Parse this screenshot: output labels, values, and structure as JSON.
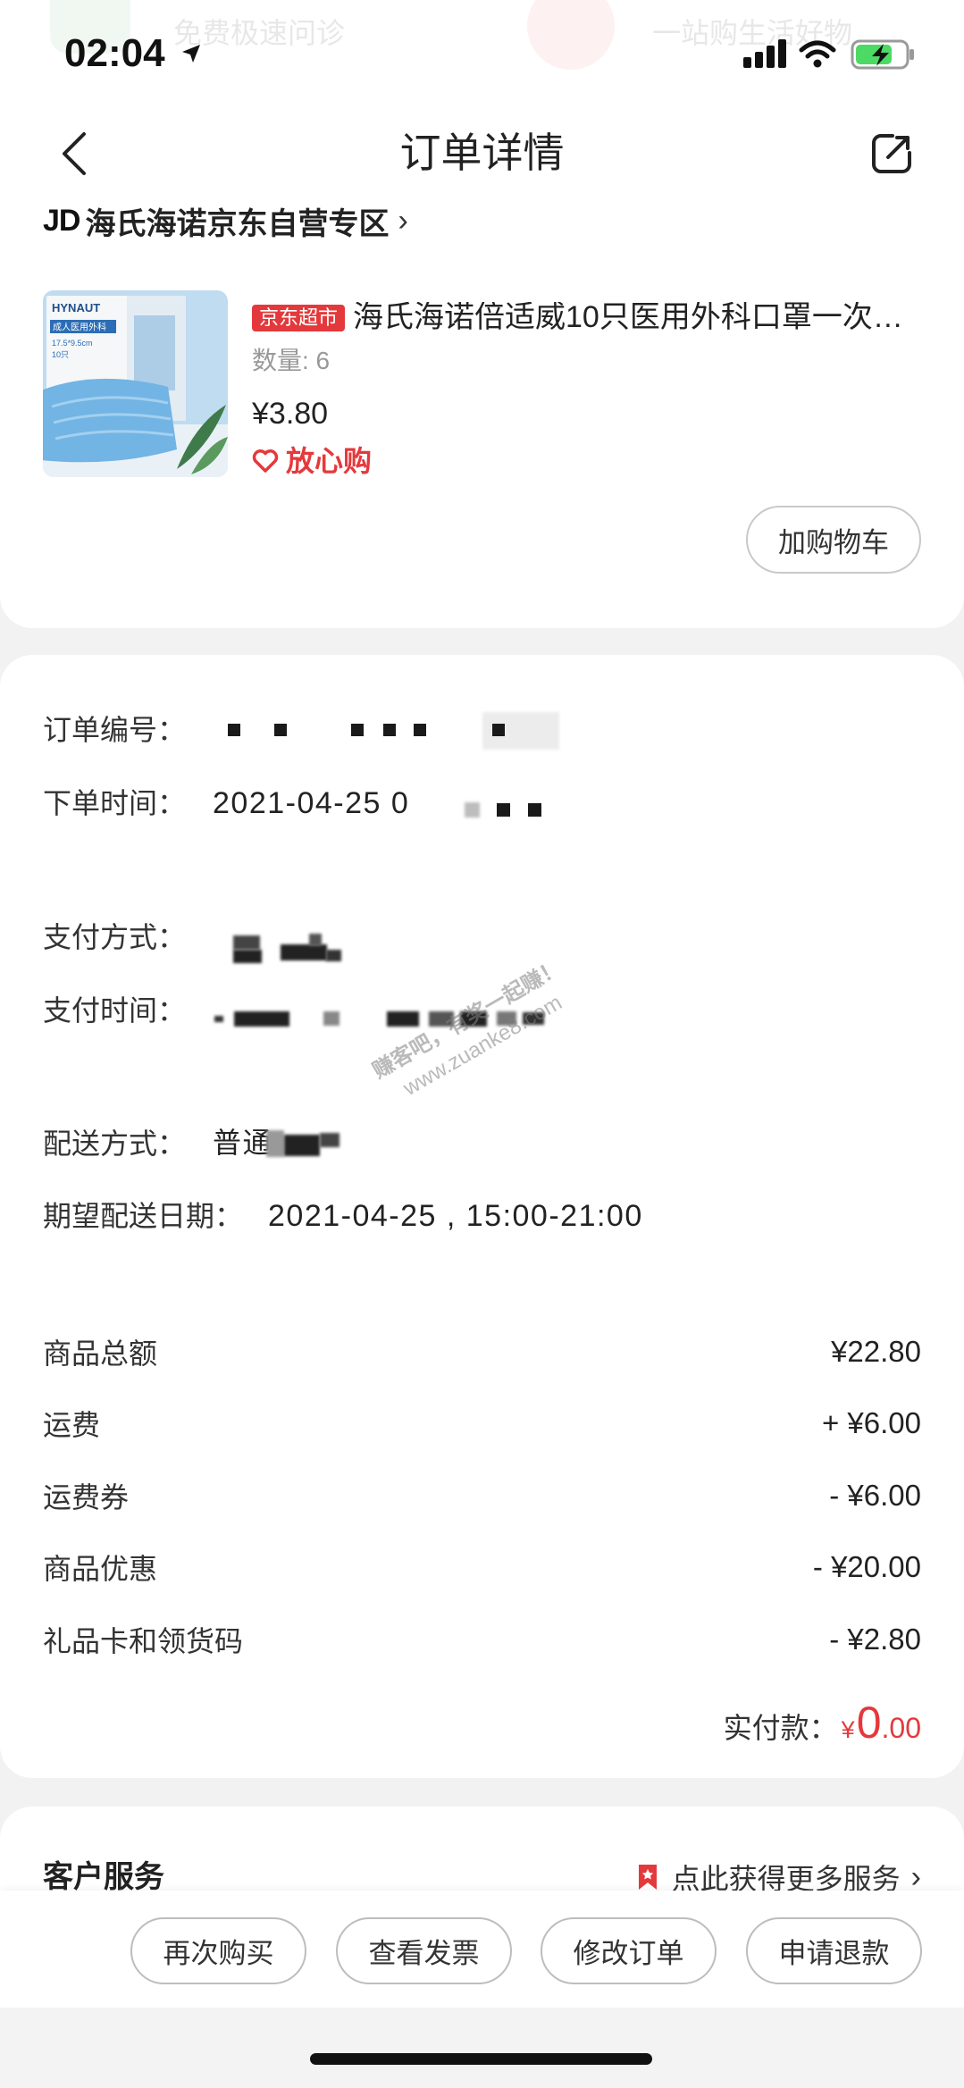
{
  "status_bar": {
    "time": "02:04"
  },
  "underlay": {
    "left_text": "免费极速问诊",
    "right_text": "一站购生活好物"
  },
  "header": {
    "title": "订单详情"
  },
  "store": {
    "logo": "JD",
    "name": "海氏海诺京东自营专区",
    "chevron": "›"
  },
  "product": {
    "image_brand": "HYNAUT",
    "image_label": "成人医用外科",
    "image_size": "17.5*9.5cm",
    "image_count": "10只",
    "tag": "京东超市",
    "title": "海氏海诺倍适威10只医用外科口罩一次…",
    "quantity": "数量: 6",
    "price": "¥3.80",
    "assurance": "放心购",
    "add_to_cart": "加购物车"
  },
  "order_info": {
    "order_no": {
      "label": "订单编号："
    },
    "order_time": {
      "label": "下单时间：",
      "value": "2021-04-25 0"
    },
    "pay_method": {
      "label": "支付方式："
    },
    "pay_time": {
      "label": "支付时间："
    },
    "delivery_method": {
      "label": "配送方式：",
      "value": "普通"
    },
    "expected_date": {
      "label": "期望配送日期：",
      "value": "2021-04-25 , 15:00-21:00"
    }
  },
  "summary": {
    "rows": [
      {
        "label": "商品总额",
        "value": "¥22.80"
      },
      {
        "label": "运费",
        "value": "+ ¥6.00"
      },
      {
        "label": "运费券",
        "value": "- ¥6.00"
      },
      {
        "label": "商品优惠",
        "value": "- ¥20.00"
      },
      {
        "label": "礼品卡和领货码",
        "value": "- ¥2.80"
      }
    ],
    "paid": {
      "label": "实付款：",
      "currency": "¥",
      "integer": "0",
      "decimal": ".00"
    }
  },
  "service": {
    "title": "客户服务",
    "link": "点此获得更多服务",
    "chevron": "›"
  },
  "actions": [
    "再次购买",
    "查看发票",
    "修改订单",
    "申请退款"
  ],
  "watermark": {
    "line1": "赚客吧，有奖一起赚！",
    "line2": "www.zuanke8.com"
  },
  "icons": {
    "back": "back-chevron-icon",
    "share": "share-icon",
    "location": "location-arrow-icon",
    "signal": "cellular-signal-icon",
    "wifi": "wifi-icon",
    "battery": "battery-charging-icon",
    "assurance": "heart-icon",
    "service": "bookmark-icon"
  },
  "colors": {
    "brand_red": "#e4393c",
    "battery_green": "#4cd964",
    "page_background": "#f2f2f2",
    "card_background": "#ffffff"
  }
}
